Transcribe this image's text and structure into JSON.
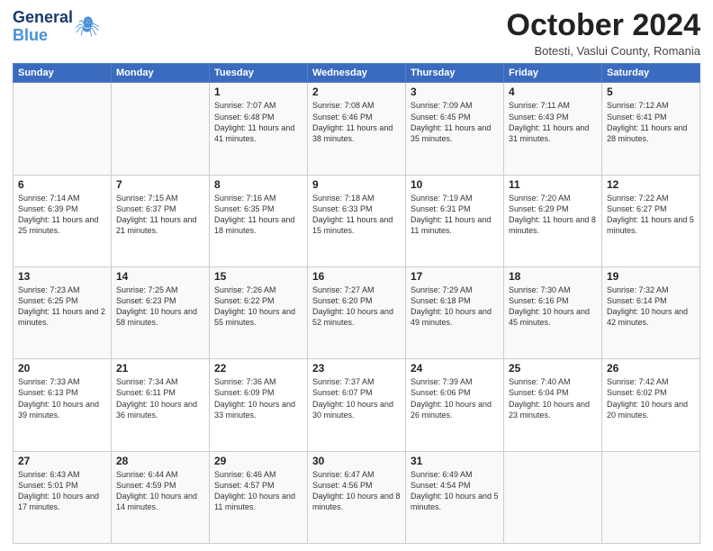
{
  "header": {
    "logo_line1": "General",
    "logo_line2": "Blue",
    "month": "October 2024",
    "location": "Botesti, Vaslui County, Romania"
  },
  "weekdays": [
    "Sunday",
    "Monday",
    "Tuesday",
    "Wednesday",
    "Thursday",
    "Friday",
    "Saturday"
  ],
  "weeks": [
    [
      {
        "day": "",
        "info": ""
      },
      {
        "day": "",
        "info": ""
      },
      {
        "day": "1",
        "info": "Sunrise: 7:07 AM\nSunset: 6:48 PM\nDaylight: 11 hours and 41 minutes."
      },
      {
        "day": "2",
        "info": "Sunrise: 7:08 AM\nSunset: 6:46 PM\nDaylight: 11 hours and 38 minutes."
      },
      {
        "day": "3",
        "info": "Sunrise: 7:09 AM\nSunset: 6:45 PM\nDaylight: 11 hours and 35 minutes."
      },
      {
        "day": "4",
        "info": "Sunrise: 7:11 AM\nSunset: 6:43 PM\nDaylight: 11 hours and 31 minutes."
      },
      {
        "day": "5",
        "info": "Sunrise: 7:12 AM\nSunset: 6:41 PM\nDaylight: 11 hours and 28 minutes."
      }
    ],
    [
      {
        "day": "6",
        "info": "Sunrise: 7:14 AM\nSunset: 6:39 PM\nDaylight: 11 hours and 25 minutes."
      },
      {
        "day": "7",
        "info": "Sunrise: 7:15 AM\nSunset: 6:37 PM\nDaylight: 11 hours and 21 minutes."
      },
      {
        "day": "8",
        "info": "Sunrise: 7:16 AM\nSunset: 6:35 PM\nDaylight: 11 hours and 18 minutes."
      },
      {
        "day": "9",
        "info": "Sunrise: 7:18 AM\nSunset: 6:33 PM\nDaylight: 11 hours and 15 minutes."
      },
      {
        "day": "10",
        "info": "Sunrise: 7:19 AM\nSunset: 6:31 PM\nDaylight: 11 hours and 11 minutes."
      },
      {
        "day": "11",
        "info": "Sunrise: 7:20 AM\nSunset: 6:29 PM\nDaylight: 11 hours and 8 minutes."
      },
      {
        "day": "12",
        "info": "Sunrise: 7:22 AM\nSunset: 6:27 PM\nDaylight: 11 hours and 5 minutes."
      }
    ],
    [
      {
        "day": "13",
        "info": "Sunrise: 7:23 AM\nSunset: 6:25 PM\nDaylight: 11 hours and 2 minutes."
      },
      {
        "day": "14",
        "info": "Sunrise: 7:25 AM\nSunset: 6:23 PM\nDaylight: 10 hours and 58 minutes."
      },
      {
        "day": "15",
        "info": "Sunrise: 7:26 AM\nSunset: 6:22 PM\nDaylight: 10 hours and 55 minutes."
      },
      {
        "day": "16",
        "info": "Sunrise: 7:27 AM\nSunset: 6:20 PM\nDaylight: 10 hours and 52 minutes."
      },
      {
        "day": "17",
        "info": "Sunrise: 7:29 AM\nSunset: 6:18 PM\nDaylight: 10 hours and 49 minutes."
      },
      {
        "day": "18",
        "info": "Sunrise: 7:30 AM\nSunset: 6:16 PM\nDaylight: 10 hours and 45 minutes."
      },
      {
        "day": "19",
        "info": "Sunrise: 7:32 AM\nSunset: 6:14 PM\nDaylight: 10 hours and 42 minutes."
      }
    ],
    [
      {
        "day": "20",
        "info": "Sunrise: 7:33 AM\nSunset: 6:13 PM\nDaylight: 10 hours and 39 minutes."
      },
      {
        "day": "21",
        "info": "Sunrise: 7:34 AM\nSunset: 6:11 PM\nDaylight: 10 hours and 36 minutes."
      },
      {
        "day": "22",
        "info": "Sunrise: 7:36 AM\nSunset: 6:09 PM\nDaylight: 10 hours and 33 minutes."
      },
      {
        "day": "23",
        "info": "Sunrise: 7:37 AM\nSunset: 6:07 PM\nDaylight: 10 hours and 30 minutes."
      },
      {
        "day": "24",
        "info": "Sunrise: 7:39 AM\nSunset: 6:06 PM\nDaylight: 10 hours and 26 minutes."
      },
      {
        "day": "25",
        "info": "Sunrise: 7:40 AM\nSunset: 6:04 PM\nDaylight: 10 hours and 23 minutes."
      },
      {
        "day": "26",
        "info": "Sunrise: 7:42 AM\nSunset: 6:02 PM\nDaylight: 10 hours and 20 minutes."
      }
    ],
    [
      {
        "day": "27",
        "info": "Sunrise: 6:43 AM\nSunset: 5:01 PM\nDaylight: 10 hours and 17 minutes."
      },
      {
        "day": "28",
        "info": "Sunrise: 6:44 AM\nSunset: 4:59 PM\nDaylight: 10 hours and 14 minutes."
      },
      {
        "day": "29",
        "info": "Sunrise: 6:46 AM\nSunset: 4:57 PM\nDaylight: 10 hours and 11 minutes."
      },
      {
        "day": "30",
        "info": "Sunrise: 6:47 AM\nSunset: 4:56 PM\nDaylight: 10 hours and 8 minutes."
      },
      {
        "day": "31",
        "info": "Sunrise: 6:49 AM\nSunset: 4:54 PM\nDaylight: 10 hours and 5 minutes."
      },
      {
        "day": "",
        "info": ""
      },
      {
        "day": "",
        "info": ""
      }
    ]
  ]
}
